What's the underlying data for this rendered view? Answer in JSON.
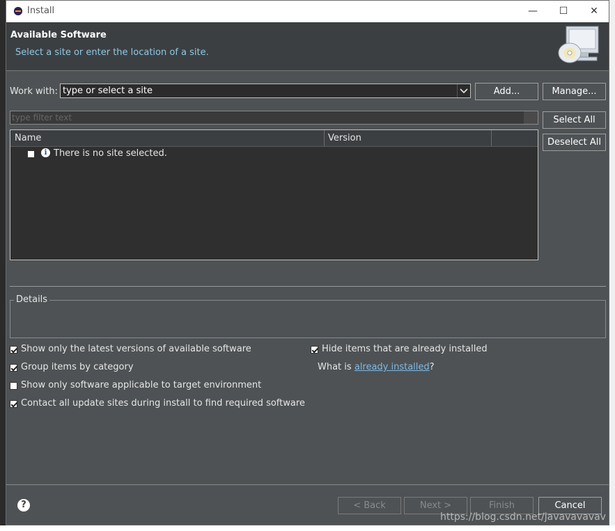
{
  "window": {
    "title": "Install",
    "minimize": "—",
    "maximize": "☐",
    "close": "✕"
  },
  "header": {
    "title": "Available Software",
    "description": "Select a site or enter the location of a site."
  },
  "work_with": {
    "label": "Work with:",
    "value": "type or select a site",
    "add_label": "Add...",
    "manage_label": "Manage..."
  },
  "filter": {
    "placeholder": "type filter text"
  },
  "table": {
    "columns": [
      "Name",
      "Version"
    ],
    "empty_message": "There is no site selected."
  },
  "side_buttons": {
    "select_all": "Select All",
    "deselect_all": "Deselect All"
  },
  "details": {
    "legend": "Details"
  },
  "options": [
    {
      "label": "Show only the latest versions of available software",
      "checked": true
    },
    {
      "label": "Group items by category",
      "checked": true
    },
    {
      "label": "Show only software applicable to target environment",
      "checked": false
    },
    {
      "label": "Contact all update sites during install to find required software",
      "checked": true
    }
  ],
  "options_right": {
    "hide_installed": {
      "label": "Hide items that are already installed",
      "checked": true
    },
    "what_is_prefix": "What is ",
    "already_installed_link": "already installed",
    "what_is_suffix": "?"
  },
  "footer": {
    "back": "< Back",
    "next": "Next >",
    "finish": "Finish",
    "cancel": "Cancel",
    "help": "?"
  },
  "watermark": "https://blog.csdn.net/javavavavav"
}
